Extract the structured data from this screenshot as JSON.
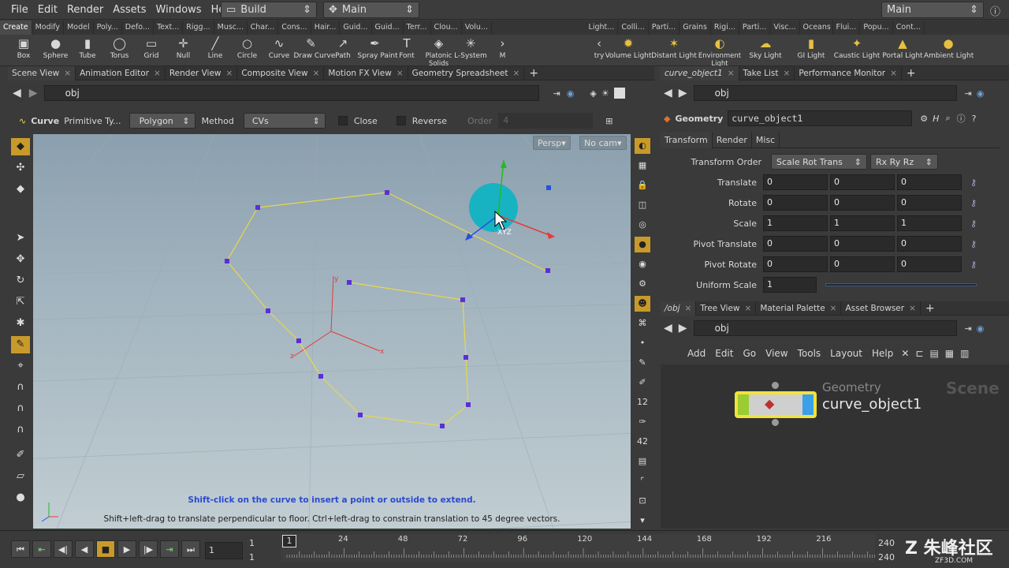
{
  "menubar": {
    "items": [
      "File",
      "Edit",
      "Render",
      "Assets",
      "Windows",
      "Help"
    ],
    "desktop": "Build",
    "scene": "Main",
    "right_scene": "Main"
  },
  "shelf": {
    "left_tabs": [
      "Create",
      "Modify",
      "Model",
      "Poly...",
      "Defo...",
      "Text...",
      "Rigg...",
      "Musc...",
      "Char...",
      "Cons...",
      "Hair...",
      "Guid...",
      "Guid...",
      "Terr...",
      "Clou...",
      "Volu..."
    ],
    "right_tabs": [
      "Light...",
      "Colli...",
      "Parti...",
      "Grains",
      "Rigi...",
      "Parti...",
      "Visc...",
      "Oceans",
      "Flui...",
      "Popu...",
      "Cont..."
    ],
    "left_tools": [
      "Box",
      "Sphere",
      "Tube",
      "Torus",
      "Grid",
      "Null",
      "Line",
      "Circle",
      "Curve",
      "Draw Curve",
      "Path",
      "Spray Paint",
      "Font",
      "Platonic Solids",
      "L-System",
      "M"
    ],
    "right_tools": [
      "try",
      "Volume Light",
      "Distant Light",
      "Environment Light",
      "Sky Light",
      "GI Light",
      "Caustic Light",
      "Portal Light",
      "Ambient Light"
    ]
  },
  "left_pane": {
    "tabs": [
      "Scene View",
      "Animation Editor",
      "Render View",
      "Composite View",
      "Motion FX View",
      "Geometry Spreadsheet"
    ],
    "path": "obj",
    "tool_bar": {
      "tool": "Curve",
      "prim_label": "Primitive Ty...",
      "prim_value": "Polygon",
      "method_label": "Method",
      "method_value": "CVs",
      "close_label": "Close",
      "reverse_label": "Reverse",
      "order_label": "Order",
      "order_value": "4"
    },
    "viewport": {
      "persp": "Persp",
      "cam": "No cam",
      "hint": "Shift-click on the curve to insert a point or outside to extend.",
      "status": "Shift+left-drag to translate perpendicular to floor. Ctrl+left-drag to constrain translation to 45 degree vectors.",
      "handle_label": "XYZ"
    }
  },
  "right_top": {
    "tabs": [
      "curve_object1",
      "Take List",
      "Performance Monitor"
    ],
    "path": "obj",
    "node_type": "Geometry",
    "node_name": "curve_object1",
    "param_tabs": [
      "Transform",
      "Render",
      "Misc"
    ],
    "transform_order_label": "Transform Order",
    "transform_order": "Scale Rot Trans",
    "rot_order": "Rx Ry Rz",
    "params": [
      {
        "label": "Translate",
        "values": [
          "0",
          "0",
          "0"
        ]
      },
      {
        "label": "Rotate",
        "values": [
          "0",
          "0",
          "0"
        ]
      },
      {
        "label": "Scale",
        "values": [
          "1",
          "1",
          "1"
        ]
      },
      {
        "label": "Pivot Translate",
        "values": [
          "0",
          "0",
          "0"
        ]
      },
      {
        "label": "Pivot Rotate",
        "values": [
          "0",
          "0",
          "0"
        ]
      }
    ],
    "uniform_scale_label": "Uniform Scale",
    "uniform_scale": "1"
  },
  "right_bottom": {
    "tabs": [
      "/obj",
      "Tree View",
      "Material Palette",
      "Asset Browser"
    ],
    "path": "obj",
    "menu": [
      "Add",
      "Edit",
      "Go",
      "View",
      "Tools",
      "Layout",
      "Help"
    ],
    "node_type": "Geometry",
    "node_name": "curve_object1",
    "context": "Scene"
  },
  "timeline": {
    "frame": "1",
    "start": "1",
    "end": "1",
    "range_start": "1",
    "range_end": "240",
    "range_end2": "240",
    "ticks": [
      "1",
      "24",
      "48",
      "72",
      "96",
      "120",
      "144",
      "168",
      "192",
      "216"
    ],
    "watermark": "朱峰社区",
    "watermark_sub": "ZF3D.COM"
  },
  "colors": {
    "accent": "#c89a2a",
    "curve": "#e8d84a",
    "point": "#5a2fd8",
    "handle": "#18b3c3"
  }
}
